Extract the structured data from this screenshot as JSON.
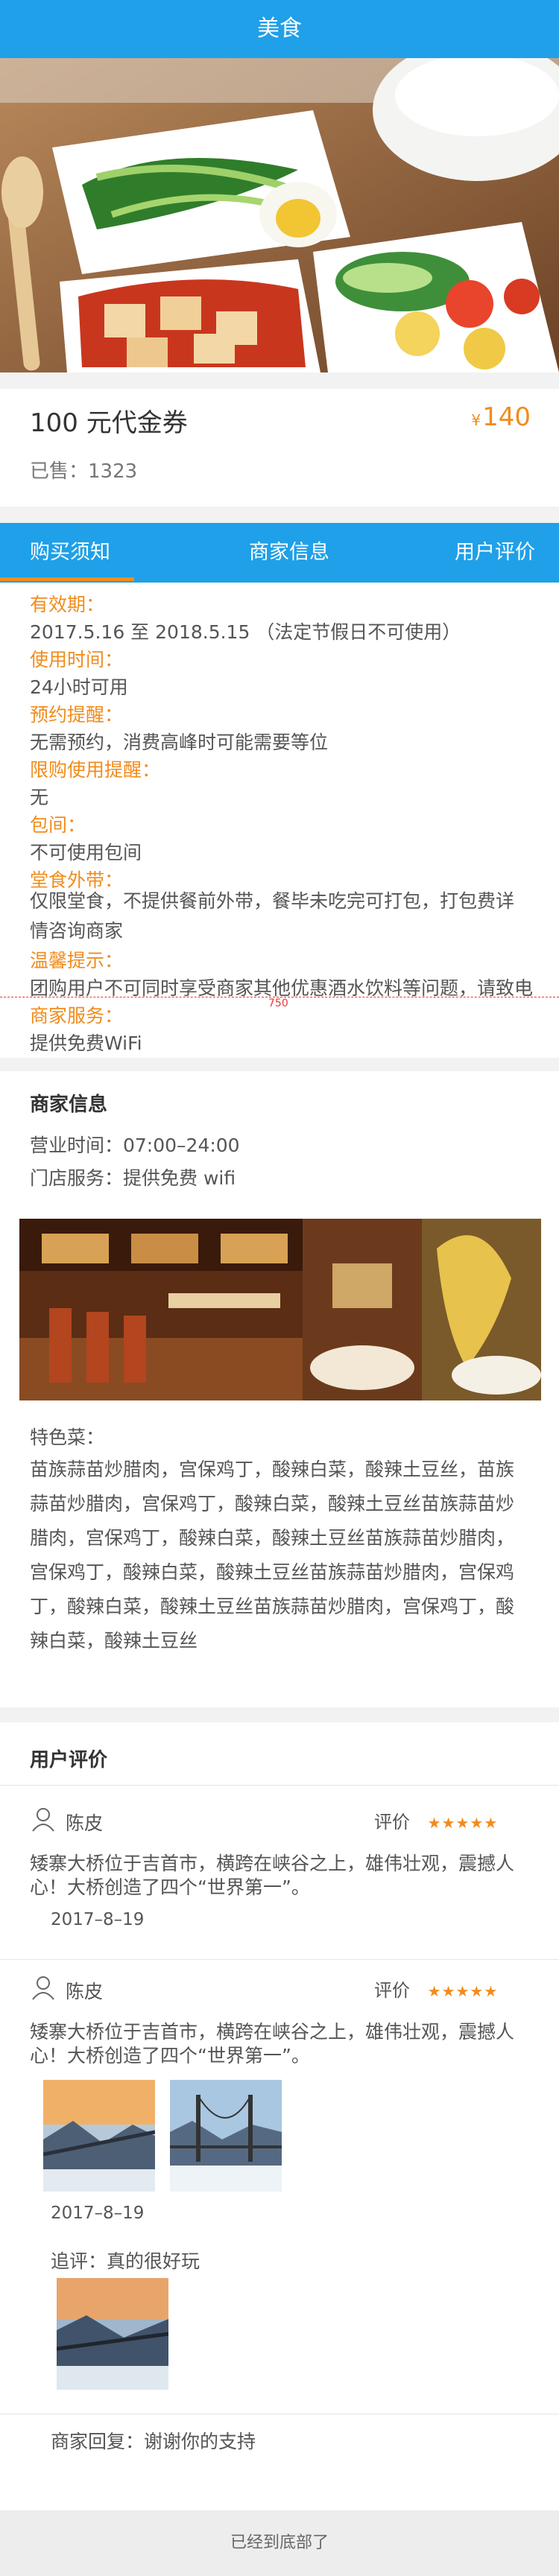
{
  "header": {
    "title": "美食"
  },
  "deal": {
    "title": "100 元代金券",
    "currency": "¥",
    "price": "140",
    "sold": "已售：1323"
  },
  "tabs": [
    {
      "label": "购买须知",
      "active": true
    },
    {
      "label": "商家信息",
      "active": false
    },
    {
      "label": "用户评价",
      "active": false
    }
  ],
  "notice": {
    "validity_label": "有效期：",
    "validity_value": "2017.5.16 至 2018.5.15 （法定节假日不可使用）",
    "time_label": "使用时间：",
    "time_value": "24小时可用",
    "booking_label": "预约提醒：",
    "booking_value": "无需预约，消费高峰时可能需要等位",
    "limit_label": "限购使用提醒：",
    "limit_value": "无",
    "room_label": "包间：",
    "room_value": "不可使用包间",
    "takeout_label": "堂食外带：",
    "takeout_value": "仅限堂食，不提供餐前外带，餐毕未吃完可打包，打包费详情咨询商家",
    "warm_label": "温馨提示：",
    "warm_value": "团购用户不可同时享受商家其他优惠酒水饮料等问题，请致电",
    "service_label": "商家服务：",
    "service_value": "提供免费WiFi",
    "ruler_label": "750"
  },
  "merchant": {
    "title": "商家信息",
    "hours": "营业时间：07:00–24:00",
    "service": "门店服务：提供免费 wifi",
    "specialty_label": "特色菜：",
    "specialty_text": "苗族蒜苗炒腊肉，宫保鸡丁，酸辣白菜，酸辣土豆丝，苗族蒜苗炒腊肉，宫保鸡丁，酸辣白菜，酸辣土豆丝苗族蒜苗炒腊肉，宫保鸡丁，酸辣白菜，酸辣土豆丝苗族蒜苗炒腊肉，宫保鸡丁，酸辣白菜，酸辣土豆丝苗族蒜苗炒腊肉，宫保鸡丁，酸辣白菜，酸辣土豆丝苗族蒜苗炒腊肉，宫保鸡丁，酸辣白菜，酸辣土豆丝"
  },
  "reviews": {
    "title": "用户评价",
    "rating_label": "评价",
    "stars": "★★★★★",
    "items": [
      {
        "user": "陈皮",
        "text": "矮寨大桥位于吉首市，横跨在峡谷之上，雄伟壮观，震撼人心！大桥创造了四个“世界第一”。",
        "date": "2017–8–19"
      },
      {
        "user": "陈皮",
        "text": "矮寨大桥位于吉首市，横跨在峡谷之上，雄伟壮观，震撼人心！大桥创造了四个“世界第一”。",
        "date": "2017–8–19",
        "followup": "追评：真的很好玩",
        "reply": "商家回复：谢谢你的支持"
      }
    ]
  },
  "footer": {
    "text": "已经到底部了"
  },
  "colors": {
    "brand_blue": "#1fa0e8",
    "accent_orange": "#f08c1d"
  }
}
